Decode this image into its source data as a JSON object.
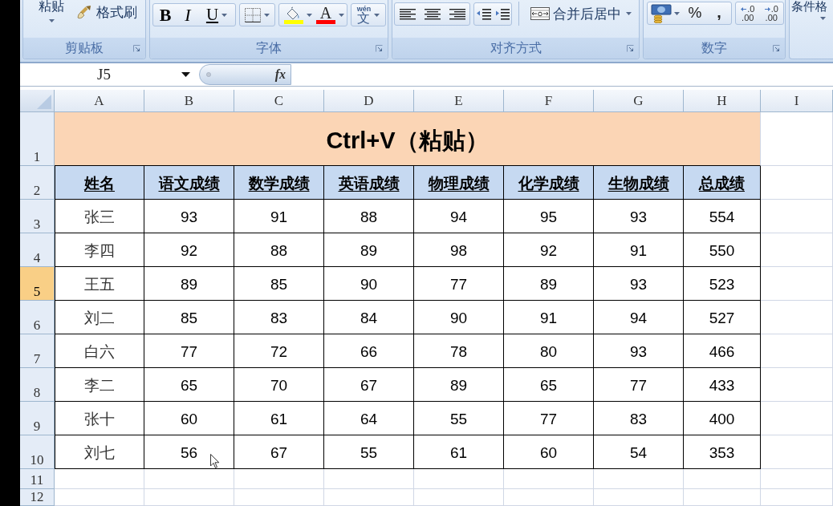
{
  "ribbon": {
    "clipboard": {
      "paste": "粘贴",
      "format_painter": "格式刷",
      "label": "剪贴板"
    },
    "font": {
      "bold": "B",
      "italic": "I",
      "underline": "U",
      "font_color": "A",
      "phonetic_top": "wén",
      "phonetic_bottom": "文",
      "label": "字体"
    },
    "alignment": {
      "merge": "合并后居中",
      "label": "对齐方式"
    },
    "number": {
      "percent": "%",
      "comma": ",",
      "increase_decimal": [
        ".0",
        ".00"
      ],
      "decrease_decimal": [
        ".0",
        ".00"
      ],
      "label": "数字"
    },
    "styles": {
      "conditional_format": "条件格"
    }
  },
  "formula_bar": {
    "name_box": "J5",
    "function_button": "fx"
  },
  "sheet": {
    "columns": [
      {
        "label": "A",
        "selected": false
      },
      {
        "label": "B",
        "selected": false
      },
      {
        "label": "C",
        "selected": false
      },
      {
        "label": "D",
        "selected": false
      },
      {
        "label": "E",
        "selected": false
      },
      {
        "label": "F",
        "selected": false
      },
      {
        "label": "G",
        "selected": false
      },
      {
        "label": "H",
        "selected": false
      },
      {
        "label": "I",
        "selected": false
      }
    ],
    "rows": [
      {
        "label": "1",
        "selected": false
      },
      {
        "label": "2",
        "selected": false
      },
      {
        "label": "3",
        "selected": false
      },
      {
        "label": "4",
        "selected": false
      },
      {
        "label": "5",
        "selected": true
      },
      {
        "label": "6",
        "selected": false
      },
      {
        "label": "7",
        "selected": false
      },
      {
        "label": "8",
        "selected": false
      },
      {
        "label": "9",
        "selected": false
      },
      {
        "label": "10",
        "selected": false
      },
      {
        "label": "11",
        "selected": false
      },
      {
        "label": "12",
        "selected": false
      }
    ],
    "title": "Ctrl+V（粘贴）",
    "headers": [
      "姓名",
      "语文成绩",
      "数学成绩",
      "英语成绩",
      "物理成绩",
      "化学成绩",
      "生物成绩",
      "总成绩"
    ],
    "records": [
      [
        "张三",
        "93",
        "91",
        "88",
        "94",
        "95",
        "93",
        "554"
      ],
      [
        "李四",
        "92",
        "88",
        "89",
        "98",
        "92",
        "91",
        "550"
      ],
      [
        "王五",
        "89",
        "85",
        "90",
        "77",
        "89",
        "93",
        "523"
      ],
      [
        "刘二",
        "85",
        "83",
        "84",
        "90",
        "91",
        "94",
        "527"
      ],
      [
        "白六",
        "77",
        "72",
        "66",
        "78",
        "80",
        "93",
        "466"
      ],
      [
        "李二",
        "65",
        "70",
        "67",
        "89",
        "65",
        "77",
        "433"
      ],
      [
        "张十",
        "60",
        "61",
        "64",
        "55",
        "77",
        "83",
        "400"
      ],
      [
        "刘七",
        "56",
        "67",
        "55",
        "61",
        "60",
        "54",
        "353"
      ]
    ]
  }
}
